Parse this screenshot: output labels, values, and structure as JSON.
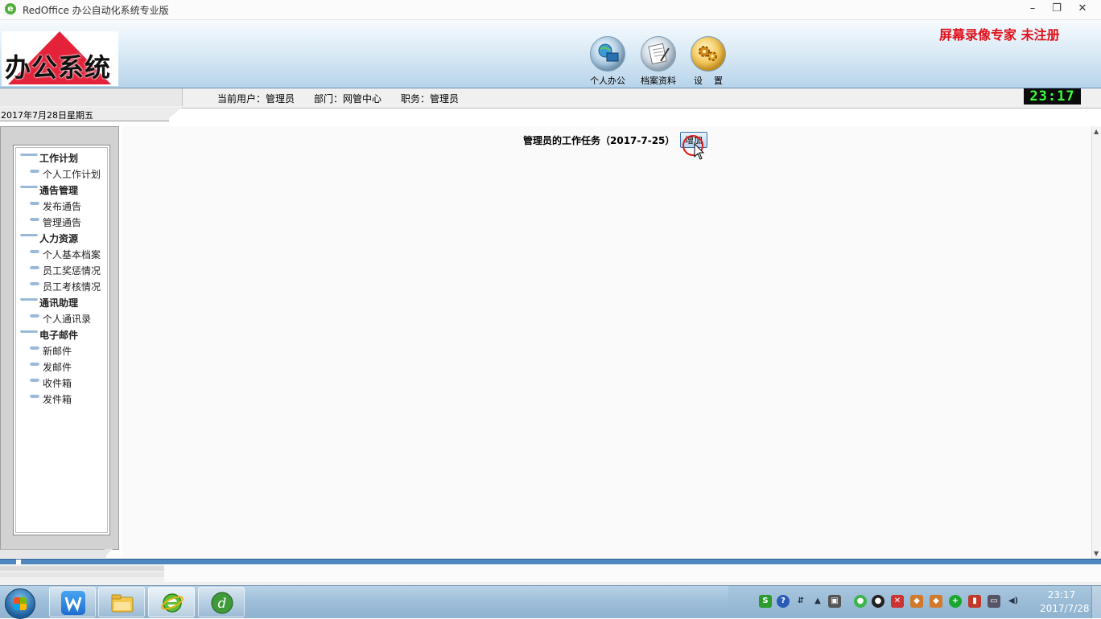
{
  "window": {
    "title": "RedOffice 办公自动化系统专业版",
    "app_icon": "e",
    "controls": [
      "–",
      "❐",
      "✕"
    ]
  },
  "banner": {
    "logo_text": "办公系统",
    "recorder_text": "屏幕录像专家  未注册",
    "nav": [
      {
        "label": "个人办公",
        "icon": "monitor-globe-icon"
      },
      {
        "label": "档案资料",
        "icon": "document-pen-icon"
      },
      {
        "label": "设    置",
        "icon": "gears-icon"
      }
    ]
  },
  "infobar": {
    "user": "当前用户：管理员",
    "dept": "部门：网管中心",
    "job": "职务：管理员",
    "clock": "23:17"
  },
  "date_tab": "2017年7月28日星期五",
  "sidebar": {
    "groups": [
      {
        "label": "工作计划",
        "items": [
          "个人工作计划"
        ]
      },
      {
        "label": "通告管理",
        "items": [
          "发布通告",
          "管理通告"
        ]
      },
      {
        "label": "人力资源",
        "items": [
          "个人基本档案",
          "员工奖惩情况",
          "员工考核情况"
        ]
      },
      {
        "label": "通讯助理",
        "items": [
          "个人通讯录"
        ]
      },
      {
        "label": "电子邮件",
        "items": [
          "新邮件",
          "发邮件",
          "收件箱",
          "发件箱"
        ]
      }
    ]
  },
  "main": {
    "task_title": "管理员的工作任务（2017-7-25）",
    "add_button": "增加"
  },
  "taskbar": {
    "apps": [
      {
        "icon": "wps-writer-icon"
      },
      {
        "icon": "file-explorer-icon"
      },
      {
        "icon": "ie-browser-icon"
      },
      {
        "icon": "dreamweaver-icon"
      }
    ],
    "time": "23:17",
    "date": "2017/7/28"
  },
  "colors": {
    "recorder_red": "#e0101a",
    "logo_red": "#e4233b",
    "clock_green": "#3cff3c",
    "taskbar": "#9fbfd9"
  }
}
